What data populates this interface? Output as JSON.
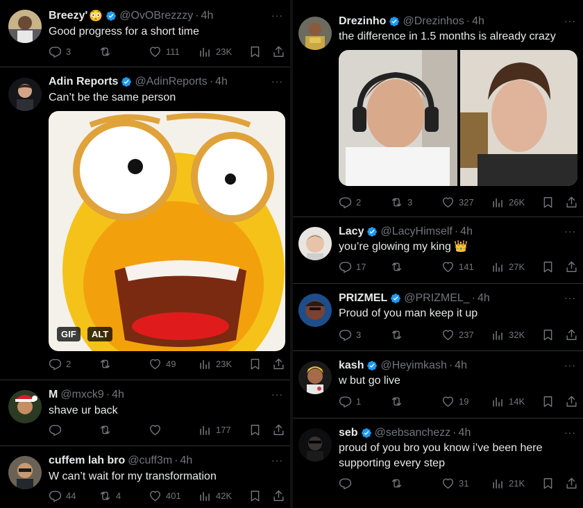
{
  "left_column": {
    "tweets": [
      {
        "name": "Breezy'",
        "name_suffix": "😳",
        "handle": "@OvOBrezzzy",
        "time": "4h",
        "text": "Good progress for a short time",
        "verified": true,
        "replies": "3",
        "retweets": "",
        "likes": "111",
        "views": "23K"
      },
      {
        "name": "Adin Reports",
        "handle": "@AdinReports",
        "time": "4h",
        "text": "Can’t be the same person",
        "verified": true,
        "media": {
          "gif_badge": "GIF",
          "alt_badge": "ALT"
        },
        "replies": "2",
        "retweets": "",
        "likes": "49",
        "views": "23K"
      },
      {
        "name": "M",
        "handle": "@mxck9",
        "time": "4h",
        "text": "shave ur back",
        "verified": false,
        "replies": "",
        "retweets": "",
        "likes": "",
        "views": "177"
      },
      {
        "name": "cuffem lah bro",
        "handle": "@cuff3m",
        "time": "4h",
        "text": "W can’t wait for my transformation",
        "verified": false,
        "replies": "44",
        "retweets": "4",
        "likes": "401",
        "views": "42K"
      }
    ]
  },
  "right_column": {
    "tweets": [
      {
        "name": "Drezinho",
        "handle": "@Drezinhos",
        "time": "4h",
        "text": "the difference in 1.5 months is already crazy",
        "verified": true,
        "replies": "2",
        "retweets": "3",
        "likes": "327",
        "views": "26K"
      },
      {
        "name": "Lacy",
        "handle": "@LacyHimself",
        "time": "4h",
        "text": "you’re glowing my king",
        "text_suffix": "👑",
        "verified": true,
        "replies": "17",
        "retweets": "",
        "likes": "141",
        "views": "27K"
      },
      {
        "name": "PRIZMEL",
        "handle": "@PRIZMEL_",
        "time": "4h",
        "text": "Proud of you man keep it up",
        "verified": true,
        "replies": "3",
        "retweets": "",
        "likes": "237",
        "views": "32K"
      },
      {
        "name": "kash",
        "handle": "@Heyimkash",
        "time": "4h",
        "text": "w but go live",
        "verified": true,
        "replies": "1",
        "retweets": "",
        "likes": "19",
        "views": "14K"
      },
      {
        "name": "seb",
        "handle": "@sebsanchezz",
        "time": "4h",
        "text": "proud of you bro you know i’ve been here supporting every step",
        "verified": true,
        "replies": "",
        "retweets": "",
        "likes": "31",
        "views": "21K"
      }
    ]
  },
  "more_glyph": "···",
  "separator": "·",
  "colors": {
    "background": "#000000",
    "text": "#e7e9ea",
    "muted": "#71767b",
    "verified": "#1d9bf0",
    "divider": "#2f3336"
  }
}
